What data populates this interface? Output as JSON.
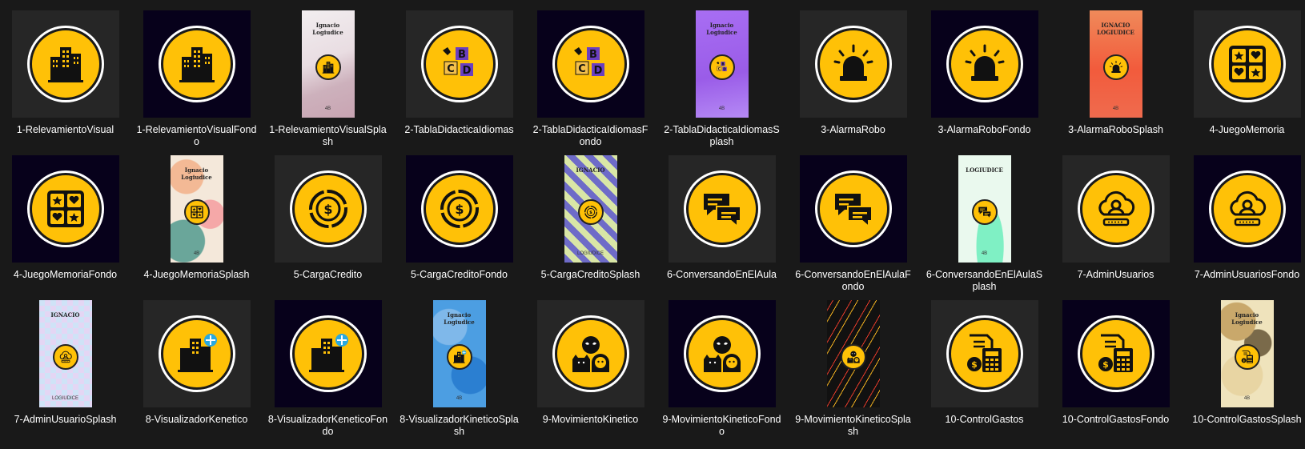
{
  "files": [
    {
      "name": "1-RelevamientoVisual",
      "kind": "square",
      "bg": "#262626",
      "icon": "buildings-icon"
    },
    {
      "name": "1-RelevamientoVisualFondo",
      "kind": "square",
      "bg": "#07011b",
      "icon": "buildings-icon"
    },
    {
      "name": "1-RelevamientoVisualSplash",
      "kind": "splash",
      "style": "pink-waves",
      "icon": "buildings-icon",
      "text_top": "Ignacio Logiudice",
      "text_bottom": "4B"
    },
    {
      "name": "2-TablaDidacticaIdiomas",
      "kind": "square",
      "bg": "#262626",
      "icon": "abc-blocks-icon"
    },
    {
      "name": "2-TablaDidacticaIdiomasFondo",
      "kind": "square",
      "bg": "#07011b",
      "icon": "abc-blocks-icon"
    },
    {
      "name": "2-TablaDidacticaIdiomasSplash",
      "kind": "splash",
      "style": "purple",
      "icon": "abc-blocks-icon",
      "text_top": "Ignacio Logiudice",
      "text_bottom": "4B"
    },
    {
      "name": "3-AlarmaRobo",
      "kind": "square",
      "bg": "#262626",
      "icon": "siren-icon"
    },
    {
      "name": "3-AlarmaRoboFondo",
      "kind": "square",
      "bg": "#07011b",
      "icon": "siren-icon"
    },
    {
      "name": "3-AlarmaRoboSplash",
      "kind": "splash",
      "style": "red-orange",
      "icon": "siren-icon",
      "text_top": "IGNACIO LOGIUDICE",
      "text_bottom": "4B"
    },
    {
      "name": "4-JuegoMemoria",
      "kind": "square",
      "bg": "#262626",
      "icon": "memory-cards-icon"
    },
    {
      "name": "4-JuegoMemoriaFondo",
      "kind": "square",
      "bg": "#07011b",
      "icon": "memory-cards-icon"
    },
    {
      "name": "4-JuegoMemoriaSplash",
      "kind": "splash",
      "style": "pastel-blobs",
      "icon": "memory-cards-icon",
      "text_top": "Ignacio Logiudice",
      "text_bottom": "4B"
    },
    {
      "name": "5-CargaCredito",
      "kind": "square",
      "bg": "#262626",
      "icon": "coin-chart-icon"
    },
    {
      "name": "5-CargaCreditoFondo",
      "kind": "square",
      "bg": "#07011b",
      "icon": "coin-chart-icon"
    },
    {
      "name": "5-CargaCreditoSplash",
      "kind": "splash",
      "style": "puzzle",
      "icon": "coin-chart-icon",
      "text_top": "IGNACIO",
      "text_bottom": "LOGIUDICE"
    },
    {
      "name": "6-ConversandoEnElAula",
      "kind": "square",
      "bg": "#262626",
      "icon": "chat-bubbles-icon"
    },
    {
      "name": "6-ConversandoEnElAulaFondo",
      "kind": "square",
      "bg": "#07011b",
      "icon": "chat-bubbles-icon"
    },
    {
      "name": "6-ConversandoEnElAulaSplash",
      "kind": "splash",
      "style": "mint",
      "icon": "chat-bubbles-icon",
      "text_top": "LOGIUDICE",
      "text_bottom": "4B"
    },
    {
      "name": "7-AdminUsuarios",
      "kind": "square",
      "bg": "#262626",
      "icon": "cloud-user-icon"
    },
    {
      "name": "7-AdminUsuariosFondo",
      "kind": "square",
      "bg": "#07011b",
      "icon": "cloud-user-icon"
    },
    {
      "name": "7-AdminUsuarioSplash",
      "kind": "splash",
      "style": "checker-pastel",
      "icon": "cloud-user-icon",
      "text_top": "IGNACIO",
      "text_bottom": "LOGIUDICE"
    },
    {
      "name": "8-VisualizadorKenetico",
      "kind": "square",
      "bg": "#262626",
      "icon": "buildings-plus-icon"
    },
    {
      "name": "8-VisualizadorKeneticoFondo",
      "kind": "square",
      "bg": "#07011b",
      "icon": "buildings-plus-icon"
    },
    {
      "name": "8-VisualizadorKineticoSplash",
      "kind": "splash",
      "style": "blue-camo",
      "icon": "buildings-plus-icon",
      "text_top": "Ignacio Logiudice",
      "text_bottom": "4B"
    },
    {
      "name": "9-MovimientoKinetico",
      "kind": "square",
      "bg": "#262626",
      "icon": "hero-faces-icon"
    },
    {
      "name": "9-MovimientoKineticoFondo",
      "kind": "square",
      "bg": "#07011b",
      "icon": "hero-faces-icon"
    },
    {
      "name": "9-MovimientoKineticoSplash",
      "kind": "splash",
      "style": "confetti-black",
      "icon": "hero-faces-icon",
      "text_top": "",
      "text_bottom": ""
    },
    {
      "name": "10-ControlGastos",
      "kind": "square",
      "bg": "#262626",
      "icon": "calculator-bill-icon"
    },
    {
      "name": "10-ControlGastosFondo",
      "kind": "square",
      "bg": "#07011b",
      "icon": "calculator-bill-icon"
    },
    {
      "name": "10-ControlGastosSplash",
      "kind": "splash",
      "style": "desert-camo",
      "icon": "calculator-bill-icon",
      "text_top": "Ignacio Logiudice",
      "text_bottom": "4B"
    }
  ]
}
